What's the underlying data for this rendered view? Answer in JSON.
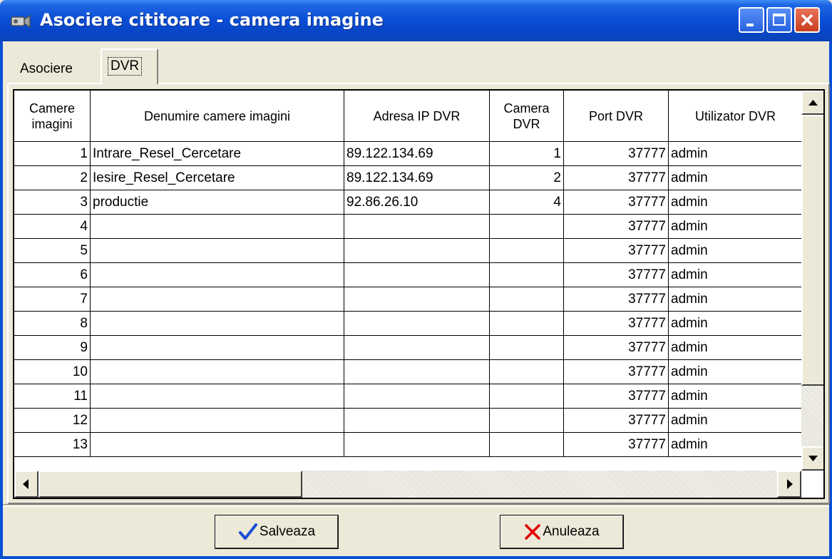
{
  "window": {
    "title": "Asociere cititoare - camera imagine",
    "title_color": "#0a4fd6"
  },
  "tabs": [
    {
      "label": "Asociere",
      "active": false
    },
    {
      "label": "DVR",
      "active": true
    }
  ],
  "grid": {
    "columns": [
      "Camere imagini",
      "Denumire camere imagini",
      "Adresa IP DVR",
      "Camera DVR",
      "Port DVR",
      "Utilizator DVR"
    ],
    "rows": [
      {
        "cam": "1",
        "name": "Intrare_Resel_Cercetare",
        "ip": "89.122.134.69",
        "dvr_cam": "1",
        "port": "37777",
        "user": "admin"
      },
      {
        "cam": "2",
        "name": "Iesire_Resel_Cercetare",
        "ip": "89.122.134.69",
        "dvr_cam": "2",
        "port": "37777",
        "user": "admin"
      },
      {
        "cam": "3",
        "name": "productie",
        "ip": "92.86.26.10",
        "dvr_cam": "4",
        "port": "37777",
        "user": "admin"
      },
      {
        "cam": "4",
        "name": "",
        "ip": "",
        "dvr_cam": "",
        "port": "37777",
        "user": "admin"
      },
      {
        "cam": "5",
        "name": "",
        "ip": "",
        "dvr_cam": "",
        "port": "37777",
        "user": "admin"
      },
      {
        "cam": "6",
        "name": "",
        "ip": "",
        "dvr_cam": "",
        "port": "37777",
        "user": "admin"
      },
      {
        "cam": "7",
        "name": "",
        "ip": "",
        "dvr_cam": "",
        "port": "37777",
        "user": "admin"
      },
      {
        "cam": "8",
        "name": "",
        "ip": "",
        "dvr_cam": "",
        "port": "37777",
        "user": "admin"
      },
      {
        "cam": "9",
        "name": "",
        "ip": "",
        "dvr_cam": "",
        "port": "37777",
        "user": "admin"
      },
      {
        "cam": "10",
        "name": "",
        "ip": "",
        "dvr_cam": "",
        "port": "37777",
        "user": "admin"
      },
      {
        "cam": "11",
        "name": "",
        "ip": "",
        "dvr_cam": "",
        "port": "37777",
        "user": "admin"
      },
      {
        "cam": "12",
        "name": "",
        "ip": "",
        "dvr_cam": "",
        "port": "37777",
        "user": "admin"
      },
      {
        "cam": "13",
        "name": "",
        "ip": "",
        "dvr_cam": "",
        "port": "37777",
        "user": "admin"
      }
    ]
  },
  "buttons": {
    "save_label": "Salveaza",
    "cancel_label": "Anuleaza",
    "save_icon": "checkmark-icon",
    "cancel_icon": "red-x-icon",
    "save_icon_color": "#1a4fd6",
    "cancel_icon_color": "#e00000"
  }
}
